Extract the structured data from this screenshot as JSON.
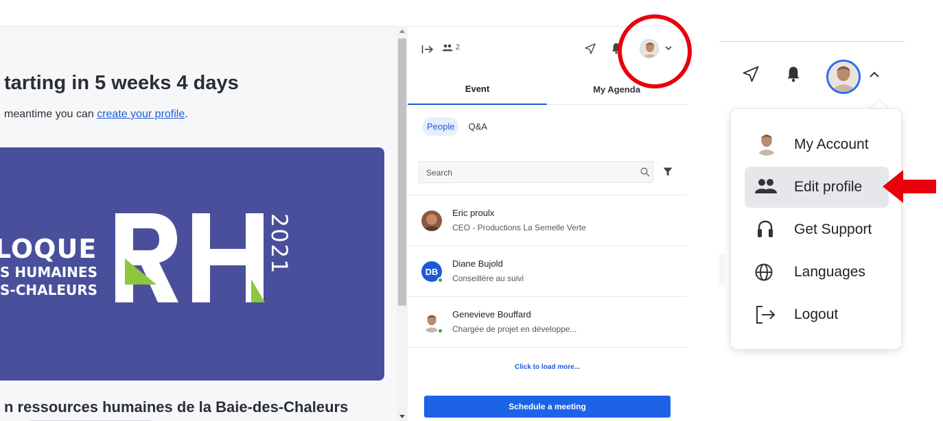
{
  "event_page": {
    "headline": "tarting in 5 weeks 4 days",
    "subline_prefix": "meantime you can ",
    "subline_link": "create your profile",
    "subline_suffix": ".",
    "banner": {
      "line1": "LOQUE",
      "line2": "S HUMAINES",
      "line3": "S-CHALEURS",
      "logo_letters": "RH",
      "year": "2021",
      "background_color": "#4a4f9c",
      "accent_color": "#8dc63f"
    },
    "bottom_title": "n ressources humaines de la Baie-des-Chaleurs"
  },
  "side_panel": {
    "attendee_count": "2",
    "icons": [
      "collapse-arrow-icon",
      "people-icon",
      "send-icon",
      "bell-icon",
      "avatar",
      "chevron-down-icon"
    ],
    "tabs": [
      {
        "label": "Event",
        "active": true
      },
      {
        "label": "My Agenda",
        "active": false
      }
    ],
    "subtabs": [
      {
        "label": "People",
        "active": true
      },
      {
        "label": "Q&A",
        "active": false
      }
    ],
    "search": {
      "placeholder": "Search",
      "value": ""
    },
    "people": [
      {
        "name": "Eric proulx",
        "role": "CEO - Productions La Semelle Verte",
        "avatar": "photo",
        "online": false
      },
      {
        "name": "Diane Bujold",
        "role": "Conseillère au suivi",
        "avatar": "initials",
        "initials": "DB",
        "online": true
      },
      {
        "name": "Genevieve Bouffard",
        "role": "Chargée de projet en développe...",
        "avatar": "photo",
        "online": true
      }
    ],
    "load_more": "Click to load more...",
    "schedule_button": "Schedule a meeting",
    "accent_color": "#1c63e8"
  },
  "account_menu": {
    "items": [
      {
        "label": "My Account",
        "icon": "avatar",
        "selected": false
      },
      {
        "label": "Edit profile",
        "icon": "people-icon",
        "selected": true
      },
      {
        "label": "Get Support",
        "icon": "headset-icon",
        "selected": false
      },
      {
        "label": "Languages",
        "icon": "globe-icon",
        "selected": false
      },
      {
        "label": "Logout",
        "icon": "logout-icon",
        "selected": false
      }
    ]
  },
  "annotations": {
    "highlight_color": "#e8000b"
  }
}
